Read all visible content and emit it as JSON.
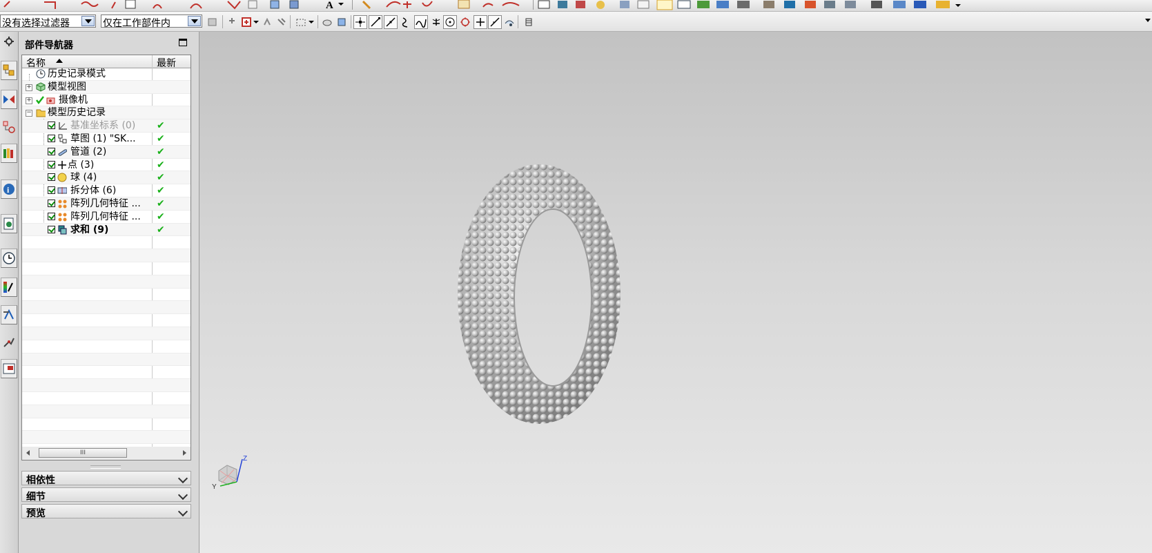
{
  "toolbar": {
    "selection_filter": "没有选择过滤器",
    "selection_scope": "仅在工作部件内"
  },
  "navigator": {
    "title": "部件导航器",
    "columns": {
      "name": "名称",
      "latest": "最新"
    },
    "nodes": [
      {
        "label": "历史记录模式",
        "icon": "clock-icon"
      },
      {
        "label": "模型视图",
        "icon": "model-views-icon"
      },
      {
        "label": "摄像机",
        "icon": "camera-icon"
      },
      {
        "label": "模型历史记录",
        "icon": "folder-icon"
      }
    ],
    "features": [
      {
        "label": "基准坐标系 (0)",
        "icon": "datum-csys-icon",
        "latest": "✔"
      },
      {
        "label": "草图 (1) \"SK...",
        "icon": "sketch-icon",
        "latest": "✔"
      },
      {
        "label": "管道 (2)",
        "icon": "tube-icon",
        "latest": "✔"
      },
      {
        "label": "点 (3)",
        "icon": "point-icon",
        "latest": "✔"
      },
      {
        "label": "球 (4)",
        "icon": "sphere-icon",
        "latest": "✔"
      },
      {
        "label": "拆分体 (6)",
        "icon": "split-body-icon",
        "latest": "✔"
      },
      {
        "label": "阵列几何特征 ...",
        "icon": "pattern-geometry-icon",
        "latest": "✔"
      },
      {
        "label": "阵列几何特征 ...",
        "icon": "pattern-geometry-icon",
        "latest": "✔"
      },
      {
        "label": "求和 (9)",
        "icon": "unite-icon",
        "latest": "✔"
      }
    ],
    "scroll_thumb": "III"
  },
  "panels": {
    "dependencies": "相依性",
    "details": "细节",
    "preview": "预览"
  },
  "triad": {
    "z": "Z",
    "y": "Y"
  },
  "colors": {
    "check_green": "#19b019",
    "combo_arrow": "#c3d4ee"
  }
}
